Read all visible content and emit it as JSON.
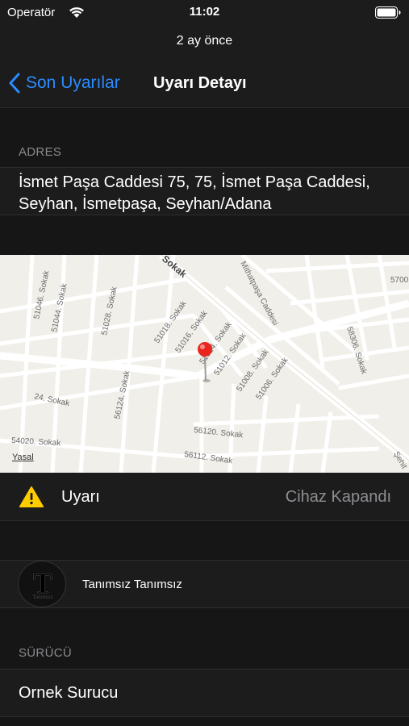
{
  "status_bar": {
    "carrier": "Operatör",
    "time": "11:02"
  },
  "prompt": "2 ay önce",
  "nav": {
    "back_label": "Son Uyarılar",
    "title": "Uyarı Detayı",
    "accent_color": "#2a8cff"
  },
  "address_section": {
    "header": "ADRES",
    "text": "İsmet Paşa Caddesi 75, 75, İsmet Paşa Caddesi, Seyhan, İsmetpaşa, Seyhan/Adana"
  },
  "map": {
    "legal": "Yasal",
    "street_labels": {
      "s51046": "51046. Sokak",
      "s51044": "51044. Sokak",
      "s51028": "51028. Sokak",
      "s51018": "51018. Sokak",
      "s51016": "51016. Sokak",
      "s51014": "51014. Sokak",
      "s51012": "51012. Sokak",
      "s51008": "51008. Sokak",
      "s51006": "51006. Sokak",
      "s56124": "56124. Sokak",
      "s24": "24. Sokak",
      "s54020": "54020. Sokak",
      "s56120": "56120. Sokak",
      "s56112": "56112. Sokak",
      "s58306": "58306. Sokak",
      "mithatpasa": "Mithatpaşa Caddesi",
      "top_partial": "Sokak",
      "right_partial": "5700",
      "corner_partial": "Şehit"
    },
    "pin_icon": "map-pin-icon"
  },
  "alert": {
    "icon": "warning-icon",
    "label": "Uyarı",
    "value": "Cihaz Kapandı"
  },
  "driver": {
    "avatar_letter": "T",
    "avatar_caption": "Tanımsız",
    "name": "Tanımsız Tanımsız"
  },
  "surucu_section": {
    "header": "SÜRÜCÜ",
    "value": "Ornek Surucu"
  }
}
